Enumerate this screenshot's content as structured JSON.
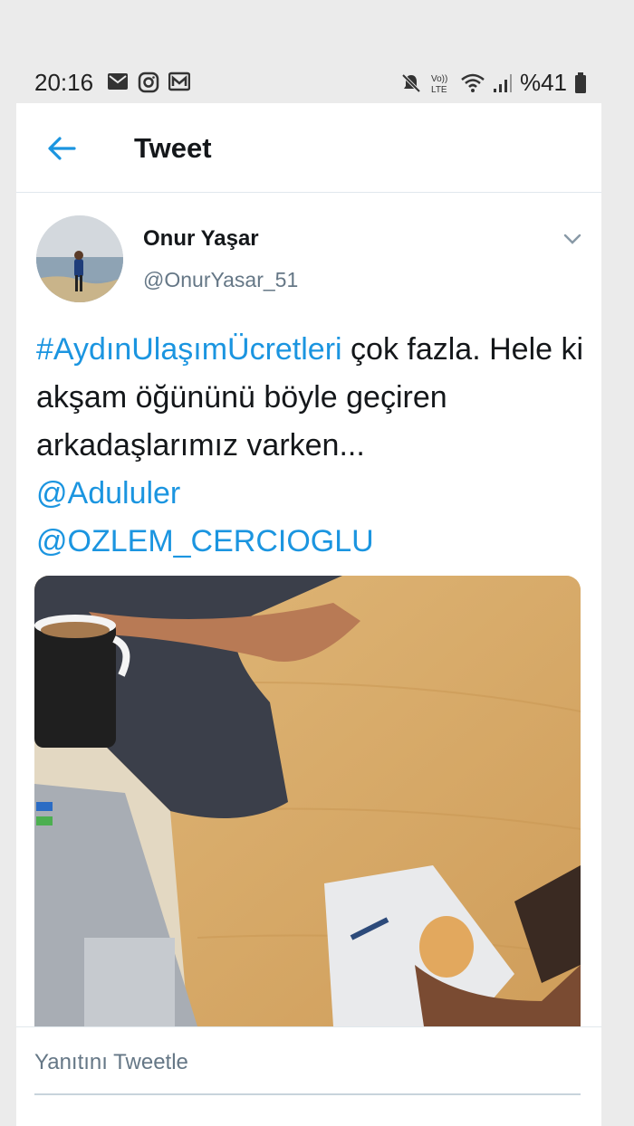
{
  "status_bar": {
    "time": "20:16",
    "battery": "%41",
    "left_icons": [
      "mail-icon",
      "instagram-icon",
      "gmail-icon"
    ],
    "right_icons": [
      "mute-icon",
      "volte-icon",
      "wifi-icon",
      "signal-icon",
      "battery-icon"
    ],
    "volte_label": "Vo)) LTE"
  },
  "header": {
    "title": "Tweet",
    "back_icon": "arrow-left-icon"
  },
  "tweet": {
    "author_name": "Onur Yaşar",
    "author_handle": "@OnurYasar_51",
    "hashtag": "#AydınUlaşımÜcretleri",
    "text_part1": " çok fazla. Hele ki akşam öğününü böyle geçiren arkadaşlarımız varken... ",
    "mention1": "@Adululer",
    "mention2": "@OZLEM_CERCIOGLU",
    "media_description_icon": "photo",
    "menu_icon": "chevron-down-icon"
  },
  "reply": {
    "placeholder": "Yanıtını Tweetle"
  },
  "colors": {
    "accent": "#1b95e0",
    "text": "#14171a",
    "secondary": "#657786",
    "background": "#ebebeb"
  }
}
